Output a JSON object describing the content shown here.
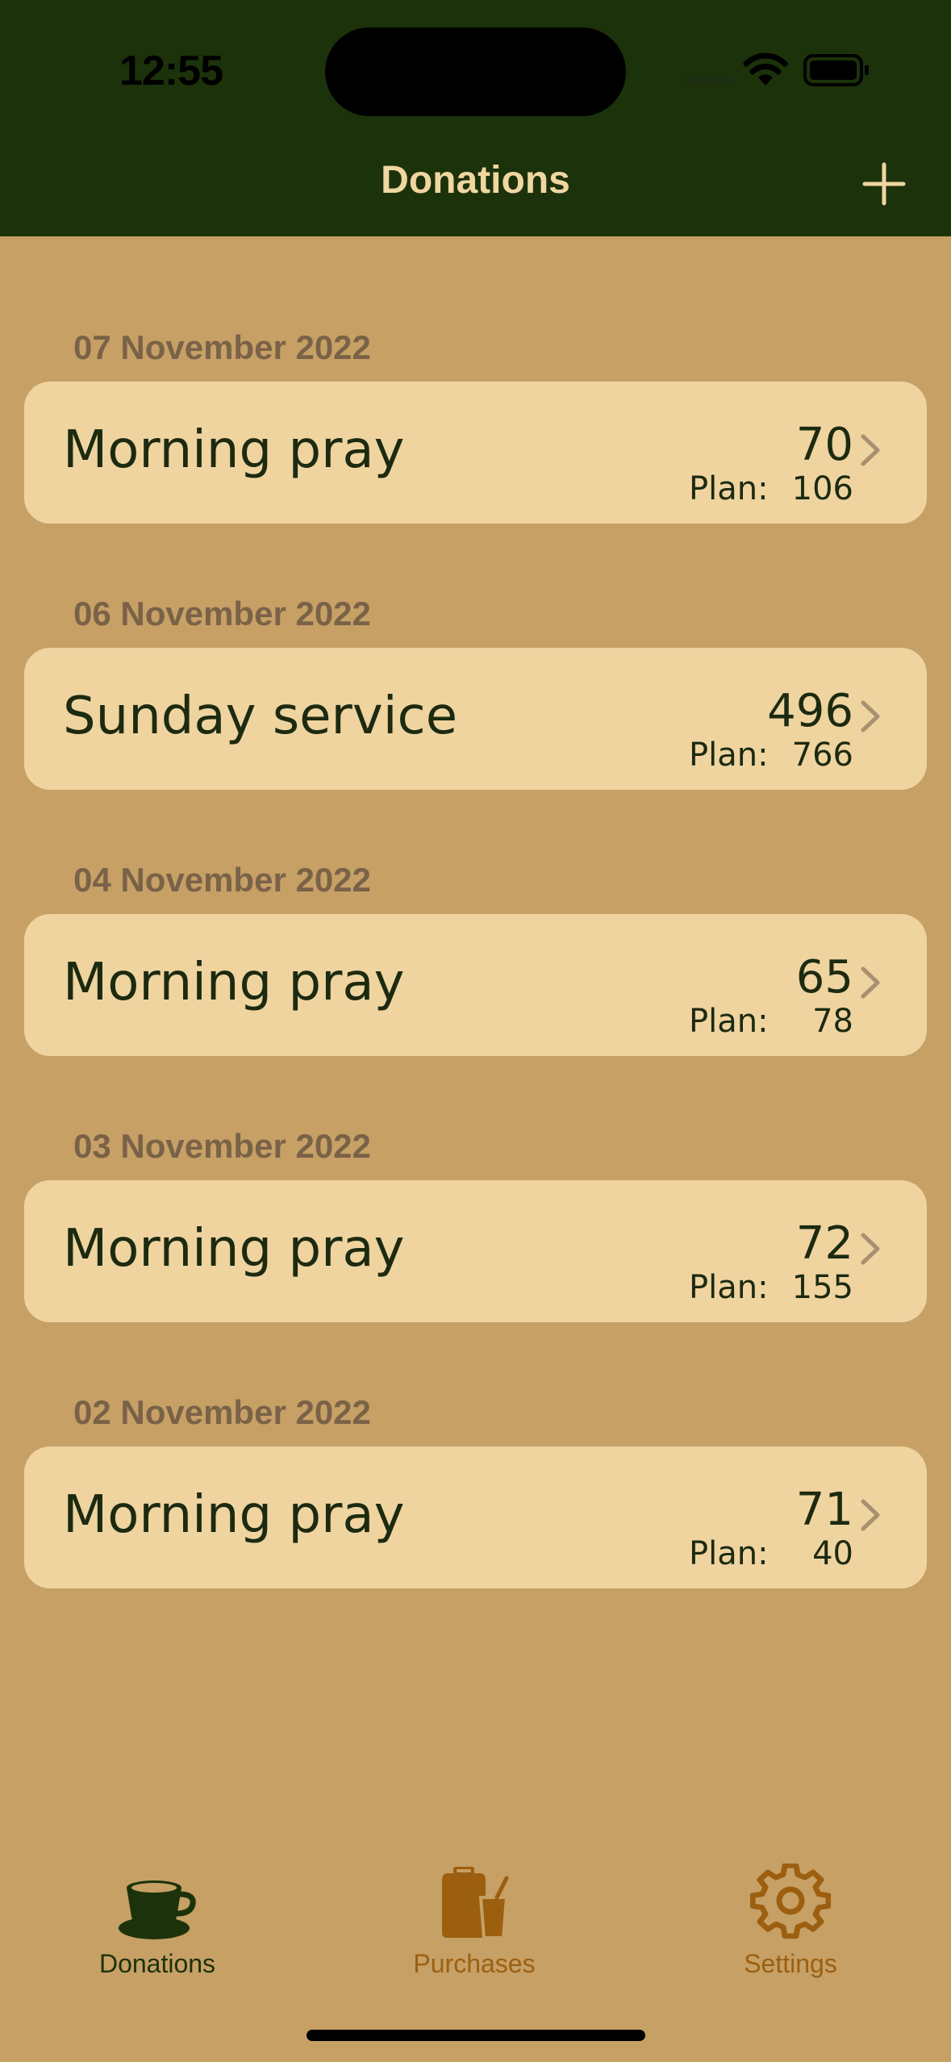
{
  "status_bar": {
    "time": "12:55"
  },
  "nav": {
    "title": "Donations",
    "add_icon": "plus-icon"
  },
  "colors": {
    "header_bg": "#1c320a",
    "page_bg": "#c6a065",
    "card_bg": "#efd4a0",
    "title_text": "#f0d6a0",
    "active_tab": "#1c320a",
    "inactive_tab": "#9c5f10"
  },
  "donations": [
    {
      "date": "07 November 2022",
      "title": "Morning pray",
      "amount": "70",
      "plan_label": "Plan:",
      "plan": "106"
    },
    {
      "date": "06 November 2022",
      "title": "Sunday service",
      "amount": "496",
      "plan_label": "Plan:",
      "plan": "766"
    },
    {
      "date": "04 November 2022",
      "title": "Morning pray",
      "amount": "65",
      "plan_label": "Plan:",
      "plan": "78"
    },
    {
      "date": "03 November 2022",
      "title": "Morning pray",
      "amount": "72",
      "plan_label": "Plan:",
      "plan": "155"
    },
    {
      "date": "02 November 2022",
      "title": "Morning pray",
      "amount": "71",
      "plan_label": "Plan:",
      "plan": "40"
    }
  ],
  "tabs": [
    {
      "label": "Donations",
      "icon": "coffee-cup-icon",
      "active": true
    },
    {
      "label": "Purchases",
      "icon": "shopping-bag-icon",
      "active": false
    },
    {
      "label": "Settings",
      "icon": "gear-icon",
      "active": false
    }
  ]
}
